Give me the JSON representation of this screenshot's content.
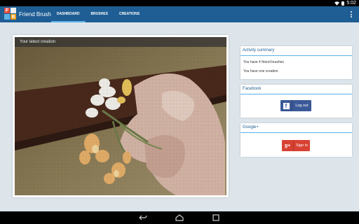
{
  "status_bar": {
    "time": "5:02"
  },
  "app": {
    "title": "Friend Brush",
    "logo_letters": [
      "F",
      "",
      "",
      "B"
    ],
    "tabs": [
      {
        "label": "DASHBOARD",
        "active": true
      },
      {
        "label": "BRUSHES",
        "active": false
      },
      {
        "label": "CREATIONS",
        "active": false
      }
    ]
  },
  "creation": {
    "caption": "Your latest creation"
  },
  "activity": {
    "title": "Activity summary",
    "lines": [
      "You have 4 friend brushes",
      "You have one creation"
    ]
  },
  "facebook": {
    "title": "Facebook",
    "button_label": "Log out",
    "icon_glyph": "f"
  },
  "google": {
    "title": "Google+",
    "button_label": "Sign in",
    "icon_glyph": "g+"
  },
  "colors": {
    "action_bar": "#1f5e94",
    "tab_indicator": "#5ab0e8",
    "background": "#dde5eb",
    "facebook": "#3b5998",
    "google": "#d84132"
  },
  "icons": [
    "wifi-icon",
    "battery-icon",
    "overflow-menu-icon",
    "back-icon",
    "home-icon",
    "recents-icon"
  ]
}
